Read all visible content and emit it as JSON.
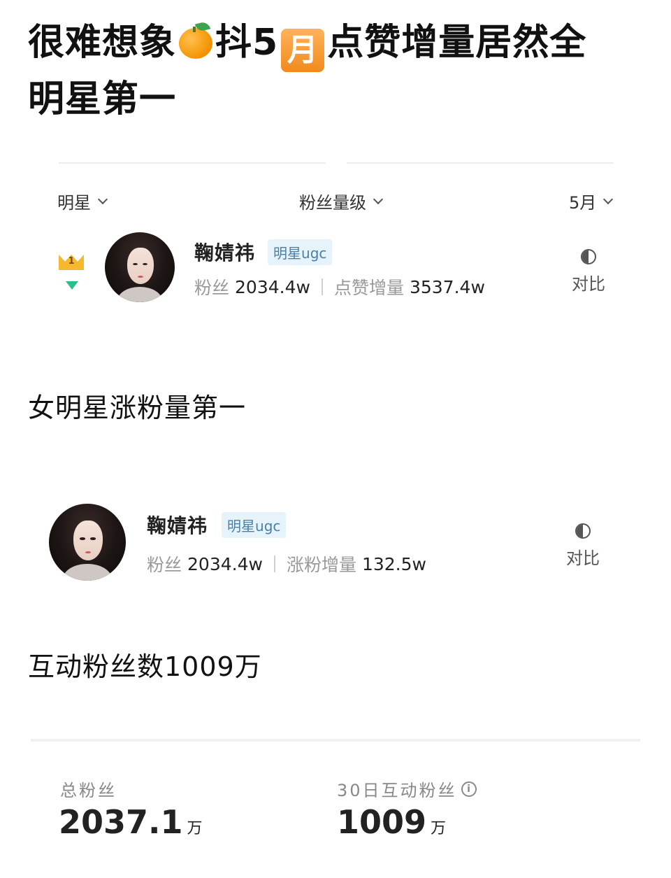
{
  "title": {
    "part1": "很难想象",
    "emoji_icon": "tangerine-icon",
    "part2": "抖5",
    "month_badge": "月",
    "part3": "点赞增量居然全",
    "line2": "明星第一"
  },
  "filters": {
    "category": "明星",
    "fans_level": "粉丝量级",
    "month": "5月"
  },
  "ranking": {
    "rank": "1",
    "trend_icon": "down-triangle-icon",
    "name": "鞠婧祎",
    "tag": "明星ugc",
    "fans_label": "粉丝",
    "fans_value": "2034.4w",
    "likes_label": "点赞增量",
    "likes_value": "3537.4w",
    "compare_label": "对比"
  },
  "heading1": "女明星涨粉量第一",
  "second_card": {
    "name": "鞠婧祎",
    "tag": "明星ugc",
    "fans_label": "粉丝",
    "fans_value": "2034.4w",
    "growth_label": "涨粉增量",
    "growth_value": "132.5w",
    "compare_label": "对比"
  },
  "heading2": "互动粉丝数1009万",
  "summary": {
    "total_label": "总粉丝",
    "total_value": "2037.1",
    "total_unit": "万",
    "active_label": "30日互动粉丝",
    "active_value": "1009",
    "active_unit": "万"
  },
  "colors": {
    "accent_green": "#2bbf8a",
    "crown_gold": "#f5b82e",
    "tag_bg": "#e6f3fb",
    "badge_orange": "#f08a1c"
  }
}
